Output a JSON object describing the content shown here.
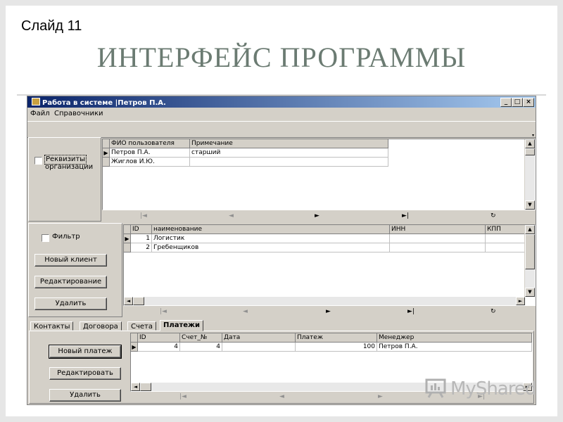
{
  "slide": {
    "number": "Слайд 11",
    "title": "ИНТЕРФЕЙС ПРОГРАММЫ"
  },
  "window": {
    "title": "Работа в системе |Петров П.А.",
    "controls": {
      "minimize": "_",
      "maximize": "□",
      "close": "×"
    }
  },
  "menu": {
    "items": [
      "Файл",
      "Справочники"
    ]
  },
  "users_panel": {
    "checkbox_label_line1": "Реквизиты",
    "checkbox_label_line2": "организации",
    "columns": [
      "ФИО пользователя",
      "Примечание"
    ],
    "rows": [
      {
        "name": "Петров П.А.",
        "note": "старший"
      },
      {
        "name": "Жиглов И.Ю.",
        "note": ""
      }
    ]
  },
  "clients_panel": {
    "filter_label": "Фильтр",
    "buttons": {
      "new_client": "Новый клиент",
      "edit": "Редактирование",
      "delete": "Удалить"
    },
    "columns": [
      "ID",
      "наименование",
      "ИНН",
      "КПП"
    ],
    "rows": [
      {
        "id": "1",
        "name": "Логистик",
        "inn": "",
        "kpp": ""
      },
      {
        "id": "2",
        "name": "Гребенщиков",
        "inn": "",
        "kpp": ""
      }
    ]
  },
  "tabs": {
    "items": [
      "Контакты",
      "Договора",
      "Счета",
      "Платежи"
    ],
    "active": "Платежи"
  },
  "payments_panel": {
    "buttons": {
      "new_payment": "Новый платеж",
      "edit": "Редактировать",
      "delete": "Удалить"
    },
    "columns": [
      "ID",
      "Счет_№",
      "Дата",
      "Платеж",
      "Менеджер"
    ],
    "rows": [
      {
        "id": "4",
        "account": "4",
        "date": "",
        "payment": "100",
        "manager": "Петров П.А."
      }
    ]
  },
  "navigator": {
    "first": "|◄",
    "prev": "◄",
    "next": "►",
    "last": "►|",
    "refresh": "↻"
  },
  "watermark": {
    "text": "MyShared",
    "icon": "presentation-board-icon"
  },
  "colors": {
    "title_text": "#6b7b72",
    "window_face": "#d4d0c8",
    "titlebar_start": "#0a246a",
    "titlebar_end": "#a6caf0"
  }
}
